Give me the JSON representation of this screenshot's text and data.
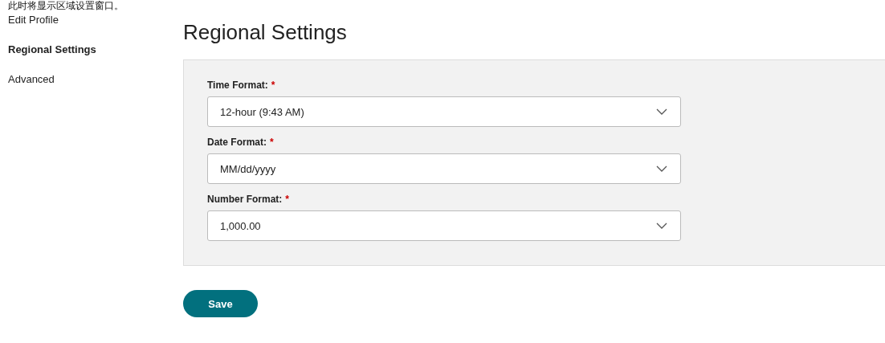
{
  "caption": "此时将显示区域设置窗口。",
  "sidebar": {
    "items": [
      {
        "label": "Edit Profile",
        "selected": false
      },
      {
        "label": "Regional Settings",
        "selected": true
      },
      {
        "label": "Advanced",
        "selected": false
      }
    ]
  },
  "heading": "Regional Settings",
  "fields": [
    {
      "label": "Time Format:",
      "required": true,
      "value": "12-hour (9:43 AM)"
    },
    {
      "label": "Date Format:",
      "required": true,
      "value": "MM/dd/yyyy"
    },
    {
      "label": "Number Format:",
      "required": true,
      "value": "1,000.00"
    }
  ],
  "required_mark": "*",
  "save_button": "Save"
}
